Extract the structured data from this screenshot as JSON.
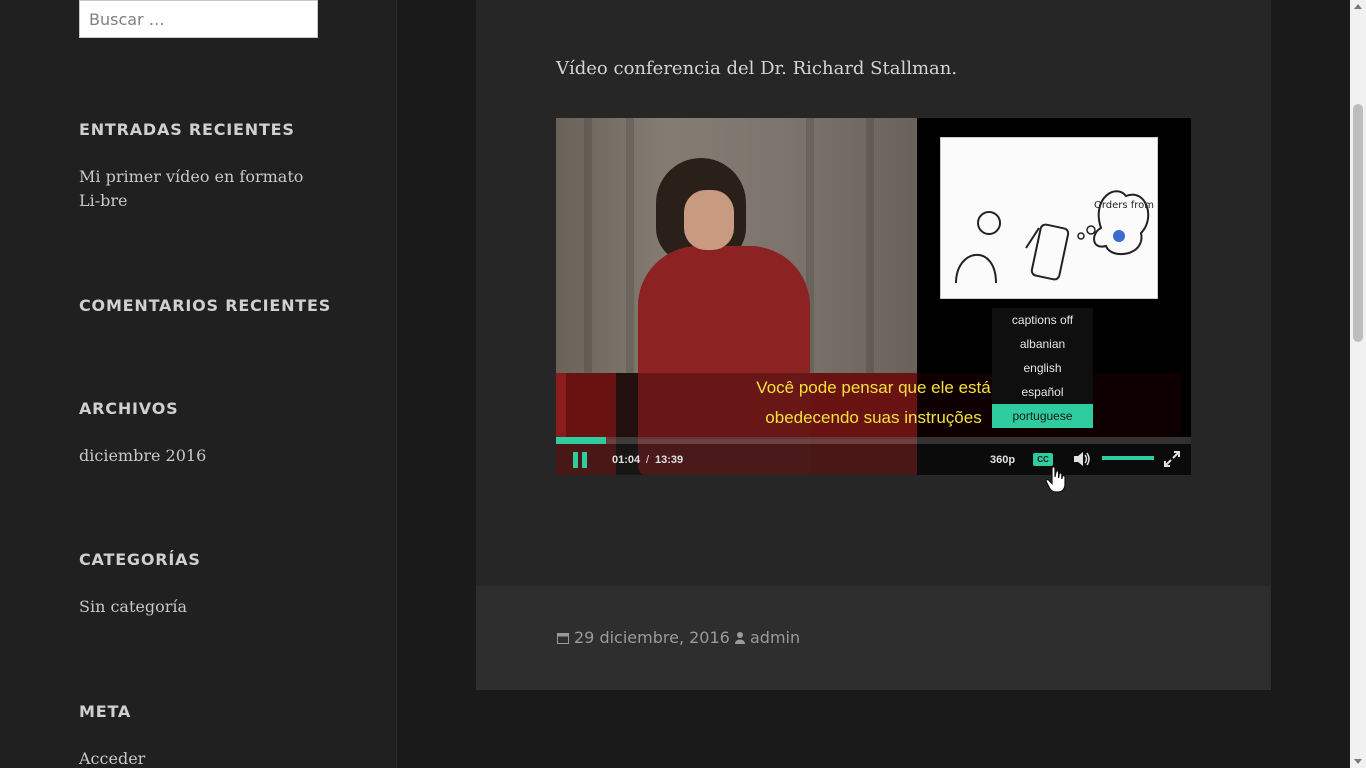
{
  "sidebar": {
    "search": {
      "placeholder": "Buscar …"
    },
    "widgets": [
      {
        "title": "ENTRADAS RECIENTES",
        "items": [
          "Mi primer vídeo en formato Li-bre"
        ]
      },
      {
        "title": "COMENTARIOS RECIENTES",
        "items": []
      },
      {
        "title": "ARCHIVOS",
        "items": [
          "diciembre 2016"
        ]
      },
      {
        "title": "CATEGORÍAS",
        "items": [
          "Sin categoría"
        ]
      },
      {
        "title": "META",
        "items": [
          "Acceder"
        ]
      }
    ]
  },
  "entry": {
    "text": "Vídeo conferencia del Dr. Richard Stallman.",
    "date": "29 diciembre, 2016",
    "author": "admin"
  },
  "player": {
    "slide_text": "Orders from",
    "subtitle_lines": [
      "Você pode pensar que ele está",
      "obedecendo suas instruções"
    ],
    "captions_menu": [
      "captions off",
      "albanian",
      "english",
      "español",
      "portuguese"
    ],
    "selected_caption": "portuguese",
    "current_time": "01:04",
    "time_separator": "/",
    "duration": "13:39",
    "quality": "360p",
    "cc_label": "CC",
    "progress_fraction": 0.078,
    "volume_fraction": 1.0,
    "icons": [
      "pause-icon",
      "volume-icon",
      "fullscreen-icon",
      "cursor-hand-icon",
      "calendar-icon",
      "user-icon"
    ],
    "accent_color": "#2ecc9e",
    "subtitle_color": "#f3e13c"
  }
}
